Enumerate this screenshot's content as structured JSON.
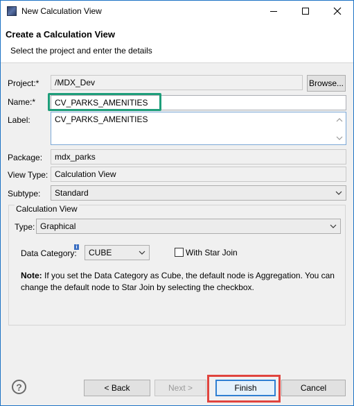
{
  "window": {
    "title": "New Calculation View"
  },
  "banner": {
    "title": "Create a Calculation View",
    "subtitle": "Select the project and enter the details"
  },
  "form": {
    "project_label": "Project:*",
    "project_value": "/MDX_Dev",
    "browse_label": "Browse...",
    "name_label": "Name:*",
    "name_value": "CV_PARKS_AMENITIES",
    "label_label": "Label:",
    "label_value": "CV_PARKS_AMENITIES",
    "package_label": "Package:",
    "package_value": "mdx_parks",
    "viewtype_label": "View Type:",
    "viewtype_value": "Calculation View",
    "subtype_label": "Subtype:",
    "subtype_value": "Standard"
  },
  "calc_view_group": {
    "title": "Calculation View",
    "type_label": "Type:",
    "type_value": "Graphical",
    "data_category_label": "Data Category:",
    "data_category_value": "CUBE",
    "star_join_label": "With Star Join",
    "star_join_checked": false,
    "note_label": "Note:",
    "note_text": "If you set the Data Category as Cube, the default node is Aggregation. You can change the default node to Star Join by selecting the checkbox."
  },
  "footer": {
    "back_label": "< Back",
    "next_label": "Next >",
    "finish_label": "Finish",
    "cancel_label": "Cancel"
  },
  "colors": {
    "name_highlight": "#1e9e7a",
    "finish_highlight": "#e0443e",
    "primary_border": "#2f7fd2"
  }
}
